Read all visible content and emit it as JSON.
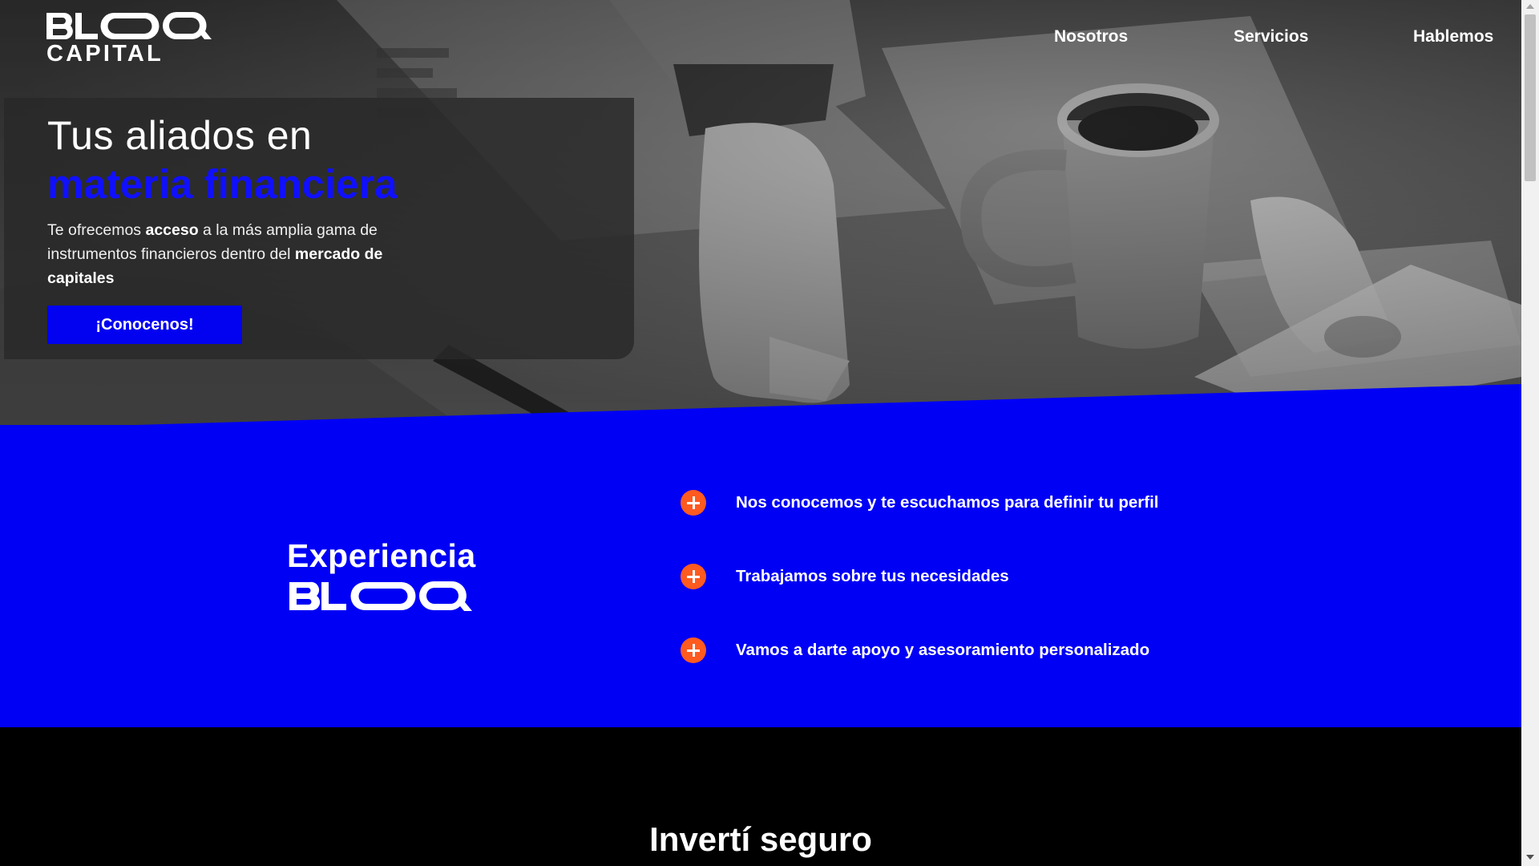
{
  "brand": {
    "logo_line1": "BL—Q",
    "logo_line2": "CAPITAL"
  },
  "nav": {
    "items": [
      {
        "label": "Nosotros"
      },
      {
        "label": "Servicios"
      },
      {
        "label": "Hablemos"
      }
    ]
  },
  "hero": {
    "title_line1": "Tus aliados en",
    "title_line2": "materia financiera",
    "text_part1": "Te ofrecemos ",
    "text_bold1": "acceso",
    "text_part2": " a la más amplia gama de instrumentos financieros dentro del ",
    "text_bold2": "mercado de capitales",
    "cta_label": "¡Conocenos!"
  },
  "experience": {
    "title": "Experiencia",
    "logo_word": "BLOQ",
    "features": [
      {
        "text": "Nos conocemos y te escuchamos para definir tu perfil"
      },
      {
        "text": "Trabajamos sobre tus necesidades"
      },
      {
        "text": "Vamos a darte apoyo y asesoramiento personalizado"
      }
    ]
  },
  "invest": {
    "title": "Invertí seguro"
  },
  "colors": {
    "brand_blue": "#0000f5",
    "accent_orange": "#ff5a1f",
    "hero_blue_text": "#1010ff"
  }
}
